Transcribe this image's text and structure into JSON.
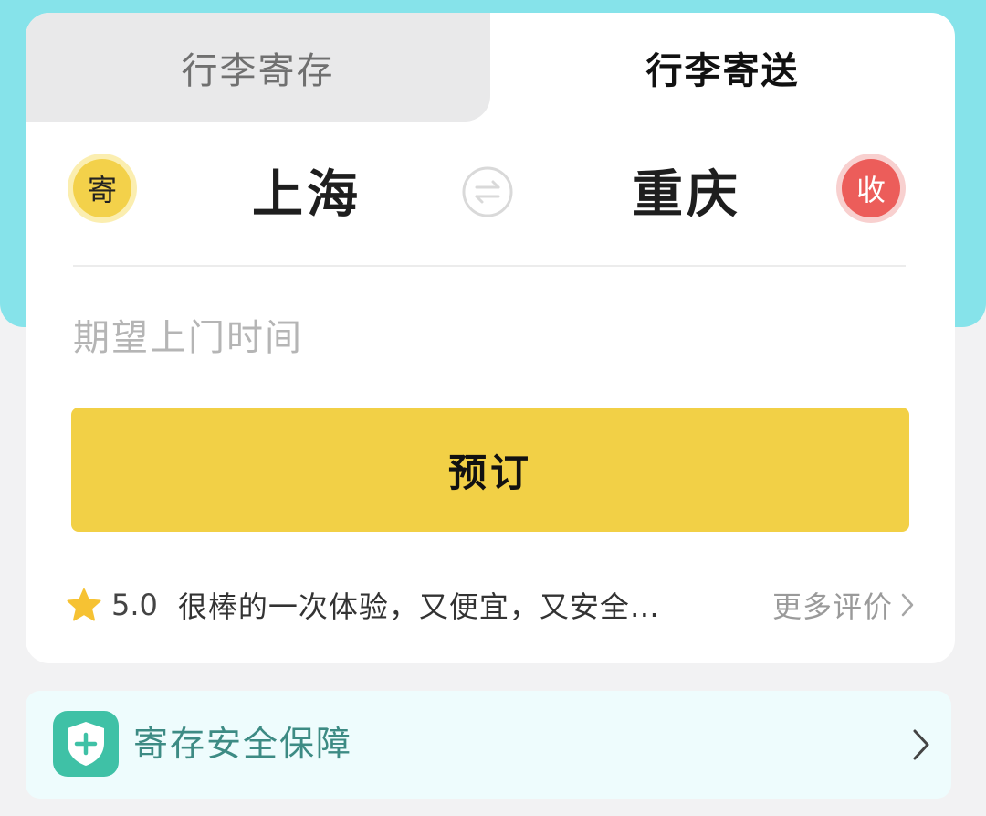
{
  "tabs": [
    {
      "label": "行李寄存",
      "active": false
    },
    {
      "label": "行李寄送",
      "active": true
    }
  ],
  "route": {
    "send_badge": "寄",
    "from_city": "上海",
    "to_city": "重庆",
    "receive_badge": "收",
    "swap_icon": "swap-arrows-icon"
  },
  "time_field": {
    "placeholder": "期望上门时间"
  },
  "book_button": {
    "label": "预订"
  },
  "review": {
    "rating": "5.0",
    "text": "很棒的一次体验，又便宜，又安全…",
    "more_label": "更多评价"
  },
  "safety": {
    "label": "寄存安全保障"
  },
  "colors": {
    "accent_yellow": "#f2d046",
    "teal_bg": "#86e3ea",
    "receive_red": "#ec5d5a",
    "shield_green": "#3fc1a6"
  }
}
